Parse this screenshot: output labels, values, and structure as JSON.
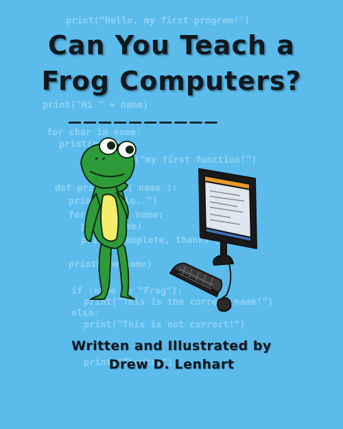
{
  "cover": {
    "title_line_1": "Can You Teach a",
    "title_line_2": "Frog Computers?",
    "title_blank": "__________",
    "credit_line_1": "Written and Illustrated by",
    "credit_line_2": "Drew D. Lenhart"
  },
  "code_lines": [
    "print(\"Hello, my first program!')",
    "print(\"Hi \" + name)",
    "for char in name:",
    "print(name)",
    "print(\"my first function!\")",
    "def printName( name ):",
    "print(\"Hello..\")",
    "for char in name:",
    "print(name)",
    "print(\"Complete, thanks\")",
    "printName(name)",
    "if (name == \"Frog\"):",
    "print(\"This is the correct name!\")",
    "else:",
    "print(\"This is not correct!\")",
    "print(\"Thanks!\")"
  ],
  "colors": {
    "background": "#5bbcec",
    "code_text": "#8fd2f3",
    "frog_green": "#2e9a3a",
    "frog_belly": "#f4ec6a",
    "title_text": "#101820"
  },
  "icons": [
    "frog-illustration",
    "monitor-illustration",
    "keyboard-illustration",
    "mouse-illustration"
  ]
}
